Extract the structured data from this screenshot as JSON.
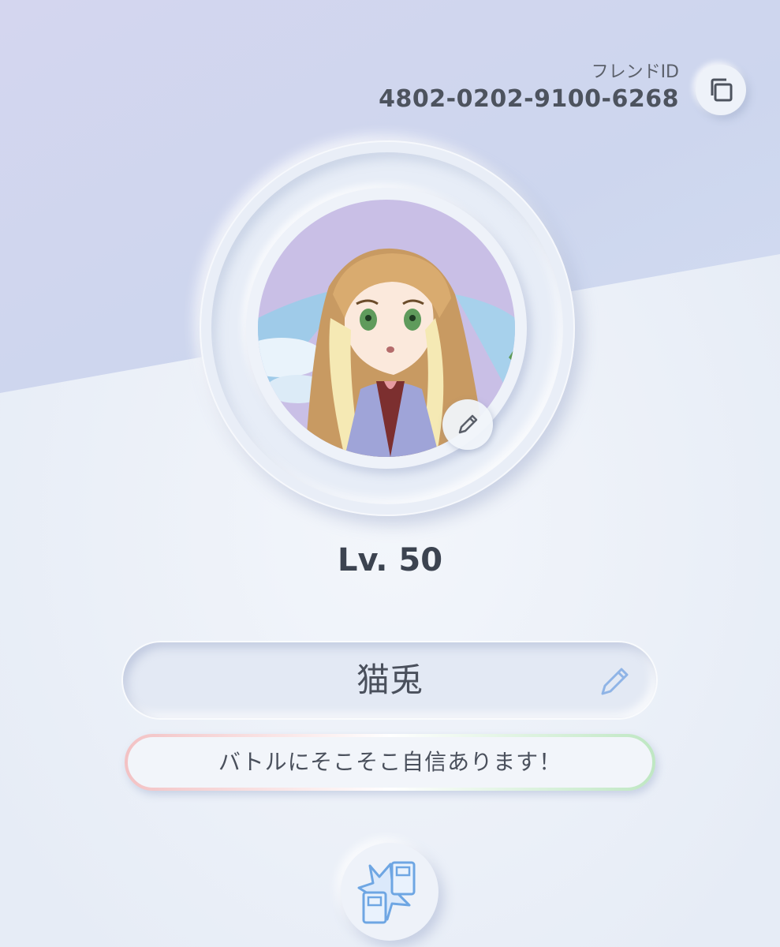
{
  "header": {
    "friend_id_label": "フレンドID",
    "friend_id_value": "4802-0202-9100-6268"
  },
  "profile": {
    "level_text": "Lv. 50",
    "player_name": "猫兎",
    "message": "バトルにそこそこ自信あります！"
  },
  "icons": {
    "copy": "copy-icon",
    "avatar_edit": "pencil-icon",
    "name_edit": "pencil-icon",
    "trade": "card-exchange-icon"
  },
  "colors": {
    "background": "#eaeff8",
    "top_band": "#cfd6ee",
    "text_primary": "#3c4350",
    "accent_blue": "#8fb4e6"
  }
}
